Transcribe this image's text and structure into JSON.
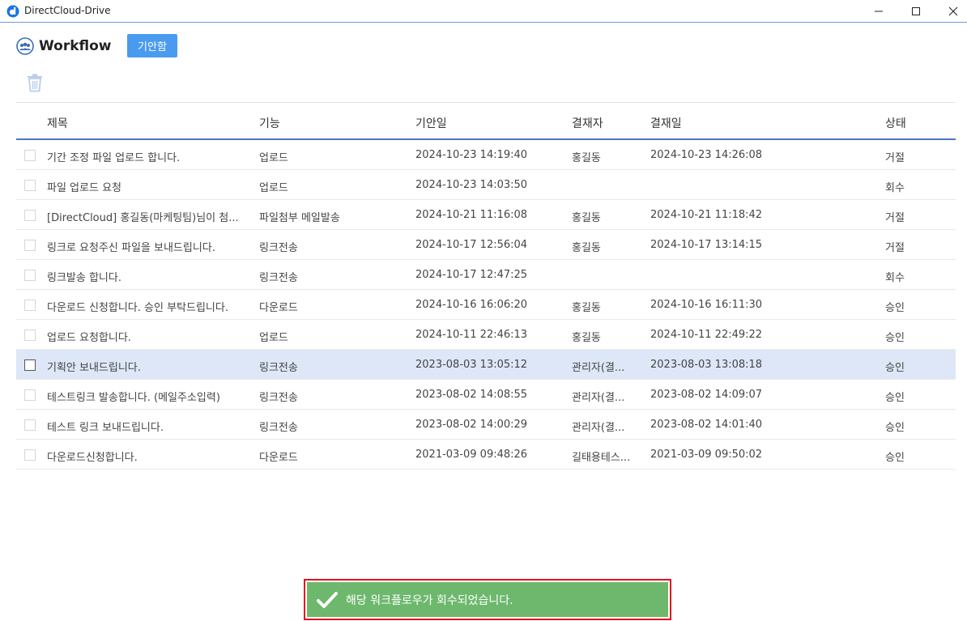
{
  "window": {
    "title": "DirectCloud-Drive"
  },
  "header": {
    "title": "Workflow",
    "tab_label": "기안함"
  },
  "table": {
    "columns": [
      "제목",
      "기능",
      "기안일",
      "결재자",
      "결재일",
      "상태"
    ],
    "rows": [
      {
        "title": "기간 조정 파일 업로드 합니다.",
        "func": "업로드",
        "date": "2024-10-23 14:19:40",
        "approver": "홍길동",
        "approved": "2024-10-23 14:26:08",
        "state": "거절"
      },
      {
        "title": "파일 업로드 요청",
        "func": "업로드",
        "date": "2024-10-23 14:03:50",
        "approver": "",
        "approved": "",
        "state": "회수"
      },
      {
        "title": "[DirectCloud] 홍길동(마케팅팀)님이 첨...",
        "func": "파일첨부 메일발송",
        "date": "2024-10-21 11:16:08",
        "approver": "홍길동",
        "approved": "2024-10-21 11:18:42",
        "state": "거절"
      },
      {
        "title": "링크로 요청주신 파일을 보내드립니다.",
        "func": "링크전송",
        "date": "2024-10-17 12:56:04",
        "approver": "홍길동",
        "approved": "2024-10-17 13:14:15",
        "state": "거절"
      },
      {
        "title": "링크발송 합니다.",
        "func": "링크전송",
        "date": "2024-10-17 12:47:25",
        "approver": "",
        "approved": "",
        "state": "회수"
      },
      {
        "title": "다운로드 신청합니다. 승인 부탁드립니다.",
        "func": "다운로드",
        "date": "2024-10-16 16:06:20",
        "approver": "홍길동",
        "approved": "2024-10-16 16:11:30",
        "state": "승인"
      },
      {
        "title": "업로드 요청합니다.",
        "func": "업로드",
        "date": "2024-10-11 22:46:13",
        "approver": "홍길동",
        "approved": "2024-10-11 22:49:22",
        "state": "승인"
      },
      {
        "title": "기획안 보내드립니다.",
        "func": "링크전송",
        "date": "2023-08-03 13:05:12",
        "approver": "관리자(결...",
        "approved": "2023-08-03 13:08:18",
        "state": "승인"
      },
      {
        "title": "테스트링크 발송합니다. (메일주소입력)",
        "func": "링크전송",
        "date": "2023-08-02 14:08:55",
        "approver": "관리자(결...",
        "approved": "2023-08-02 14:09:07",
        "state": "승인"
      },
      {
        "title": "테스트 링크 보내드립니다.",
        "func": "링크전송",
        "date": "2023-08-02 14:00:29",
        "approver": "관리자(결...",
        "approved": "2023-08-02 14:01:40",
        "state": "승인"
      },
      {
        "title": "다운로드신청합니다.",
        "func": "다운로드",
        "date": "2021-03-09 09:48:26",
        "approver": "길태용테스...",
        "approved": "2021-03-09 09:50:02",
        "state": "승인"
      }
    ]
  },
  "toast": {
    "message": "해당 워크플로우가 회수되었습니다."
  },
  "colors": {
    "accent": "#4a9bf0",
    "selected_row": "#dde7f8",
    "toast_bg": "#6db86d",
    "toast_border": "#e0141e"
  },
  "icons": {
    "app": "directcloud-logo-icon",
    "workflow": "workflow-people-icon",
    "delete": "trash-icon",
    "toast": "check-icon"
  }
}
